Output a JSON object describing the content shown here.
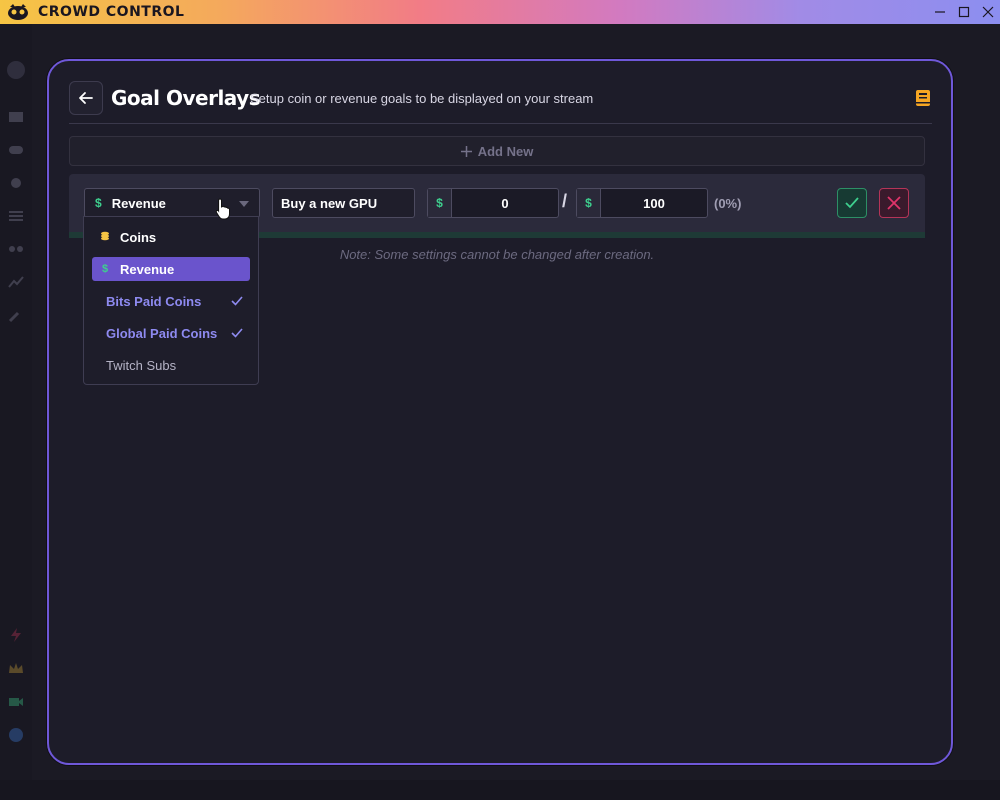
{
  "window": {
    "title": "CROWD CONTROL",
    "controls": {
      "minimize": "minimize-icon",
      "maximize": "maximize-icon",
      "close": "close-icon"
    }
  },
  "modal": {
    "title": "Goal Overlays",
    "subtitle": "Setup coin or revenue goals to be displayed on your stream",
    "add_new_label": "Add New",
    "note": "Note: Some settings cannot be changed after creation."
  },
  "goal": {
    "type_label": "Revenue",
    "type_icon": "$",
    "name_value": "Buy a new GPU",
    "current_prefix": "$",
    "current_value": "0",
    "separator": "/",
    "target_prefix": "$",
    "target_value": "100",
    "percent": "(0%)"
  },
  "dropdown": {
    "items": [
      {
        "label": "Coins",
        "icon": "coins-icon",
        "state": "normal"
      },
      {
        "label": "Revenue",
        "icon": "$",
        "state": "selected"
      },
      {
        "label": "Bits Paid Coins",
        "state": "checked"
      },
      {
        "label": "Global Paid Coins",
        "state": "checked"
      },
      {
        "label": "Twitch Subs",
        "state": "plain"
      }
    ]
  },
  "colors": {
    "accent": "#6f58d9",
    "selected": "#6a54cc",
    "success": "#3ecf8e",
    "danger": "#e0346a",
    "coin": "#f6c544"
  }
}
